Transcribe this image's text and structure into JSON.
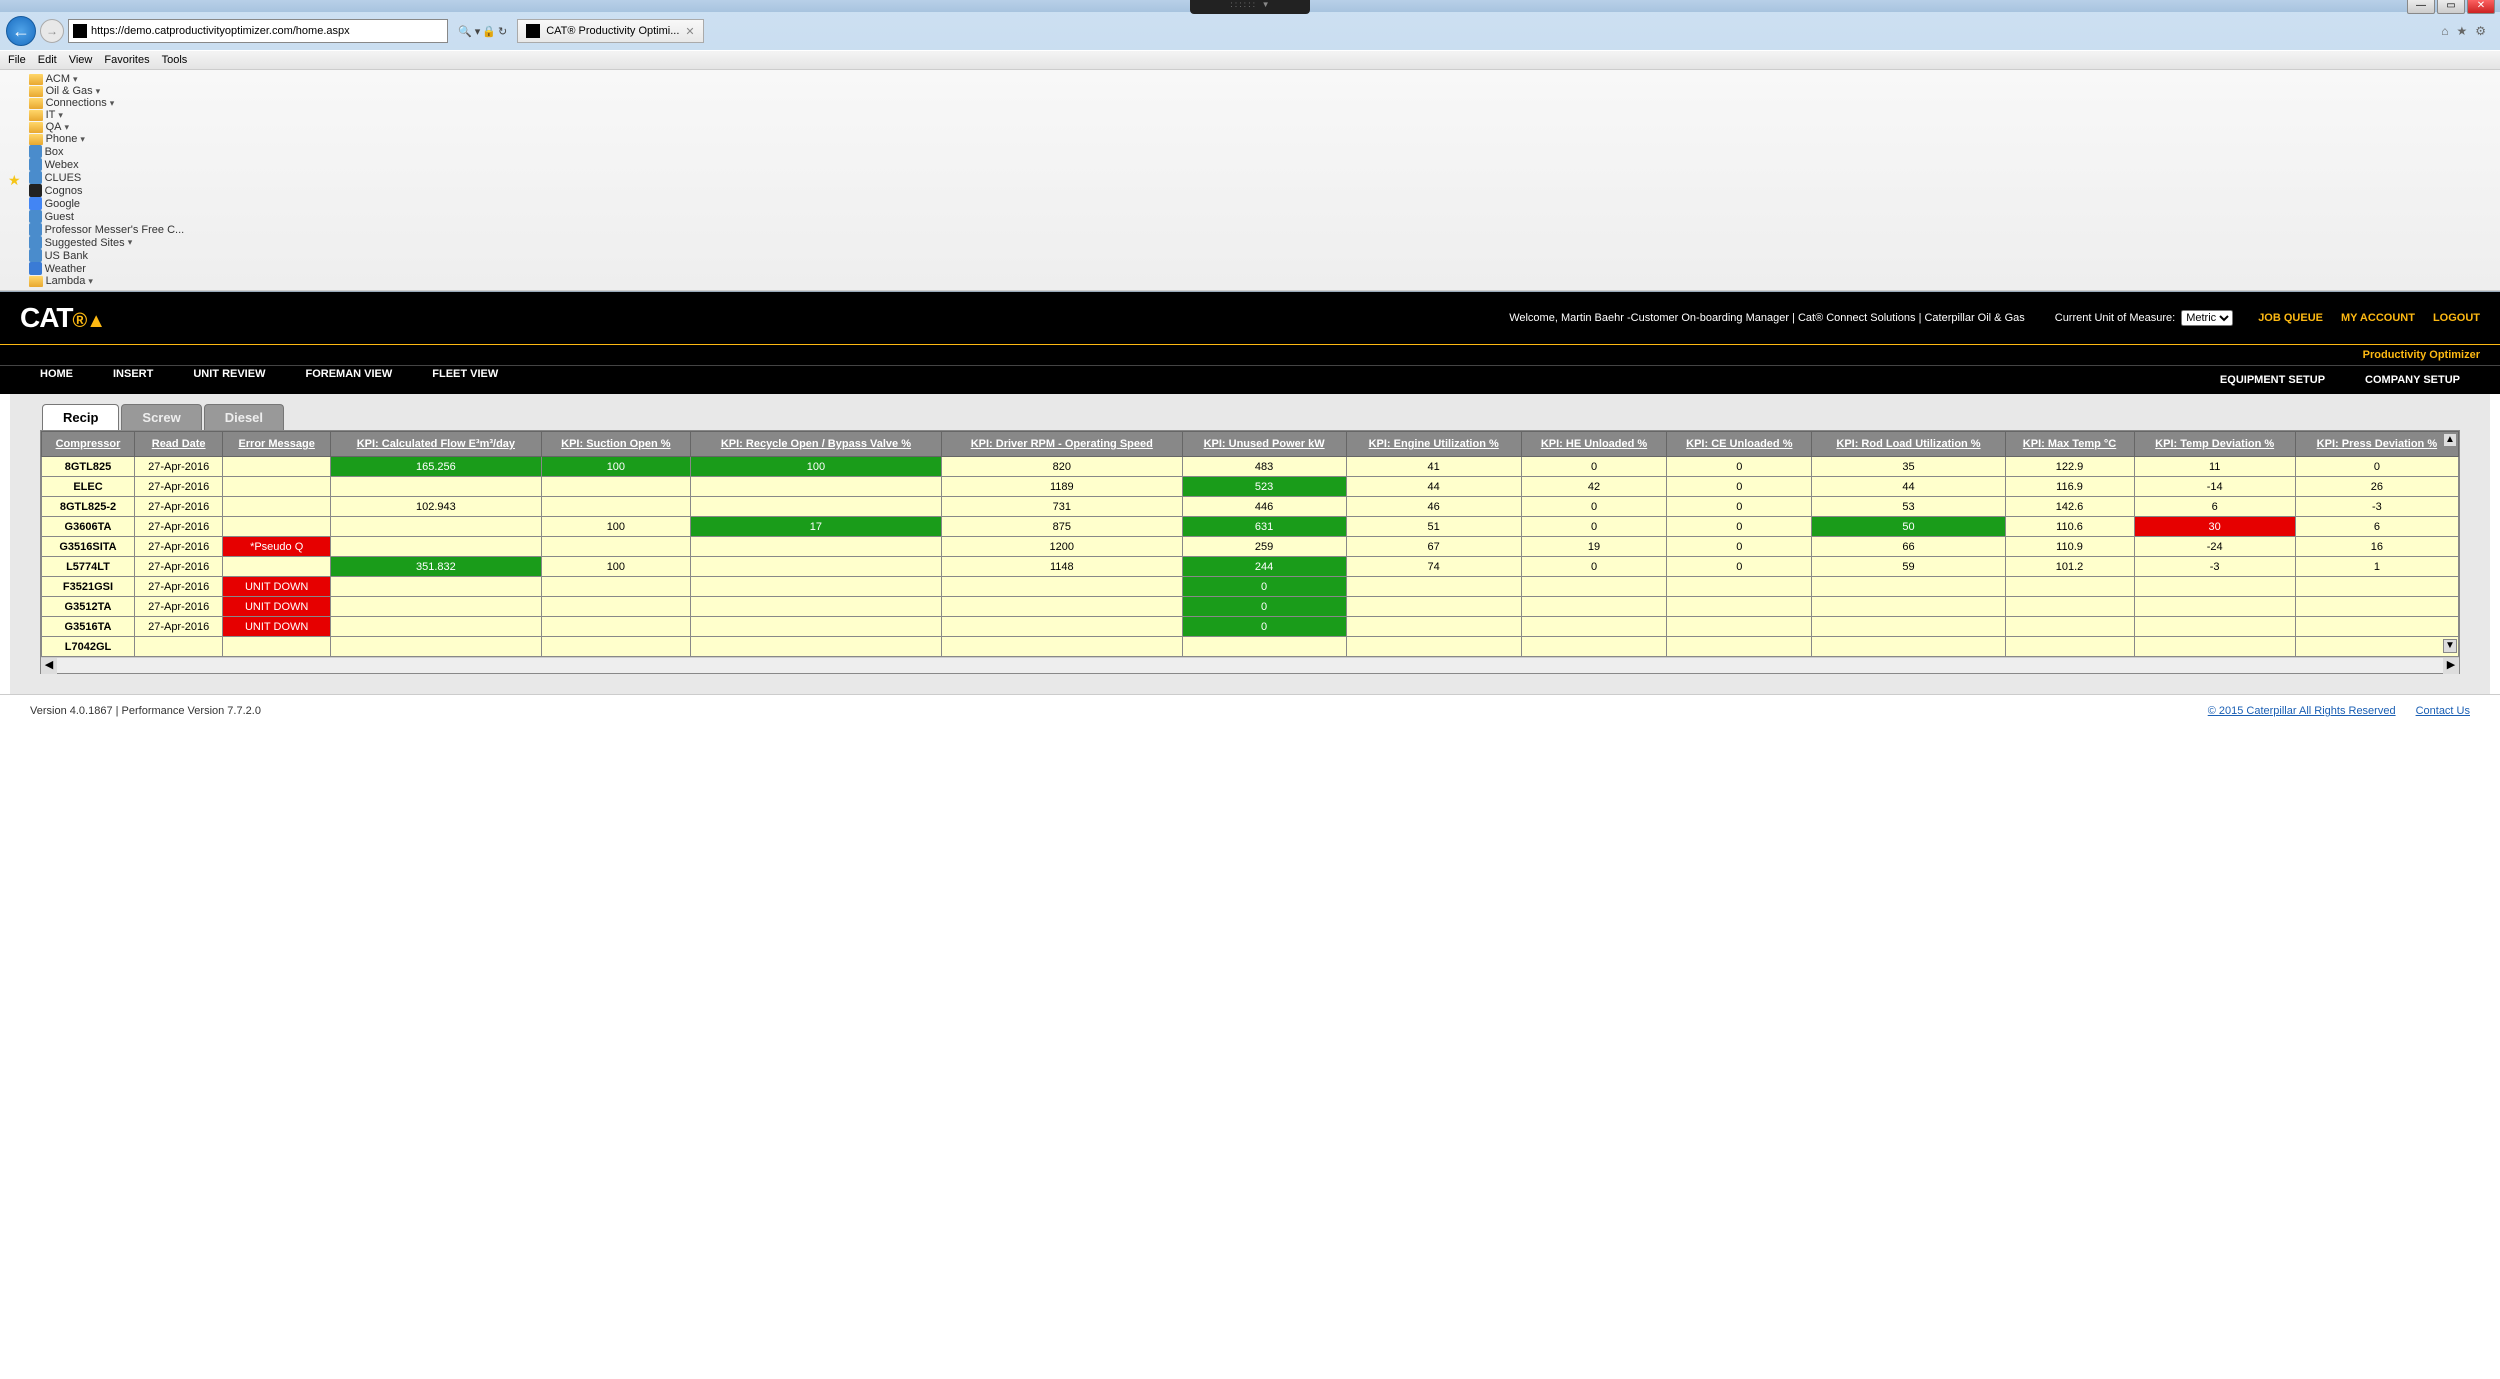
{
  "browser": {
    "url": "https://demo.catproductivityoptimizer.com/home.aspx",
    "tab_title": "CAT® Productivity Optimi...",
    "menus": [
      "File",
      "Edit",
      "View",
      "Favorites",
      "Tools"
    ],
    "favorites": [
      {
        "type": "folder",
        "label": "ACM",
        "arrow": true
      },
      {
        "type": "folder",
        "label": "Oil & Gas",
        "arrow": true
      },
      {
        "type": "folder",
        "label": "Connections",
        "arrow": true
      },
      {
        "type": "folder",
        "label": "IT",
        "arrow": true
      },
      {
        "type": "folder",
        "label": "QA",
        "arrow": true
      },
      {
        "type": "folder",
        "label": "Phone",
        "arrow": true
      },
      {
        "type": "icon",
        "label": "Box"
      },
      {
        "type": "icon",
        "label": "Webex"
      },
      {
        "type": "icon",
        "label": "CLUES"
      },
      {
        "type": "icon",
        "label": "Cognos",
        "bg": "#222"
      },
      {
        "type": "icon",
        "label": "Google",
        "bg": "#4285f4"
      },
      {
        "type": "icon",
        "label": "Guest"
      },
      {
        "type": "icon",
        "label": "Professor Messer's Free C..."
      },
      {
        "type": "icon",
        "label": "Suggested Sites",
        "arrow": true
      },
      {
        "type": "icon",
        "label": "US Bank"
      },
      {
        "type": "icon",
        "label": "Weather",
        "bg": "#3a7bd5"
      },
      {
        "type": "folder",
        "label": "Lambda",
        "arrow": true
      }
    ]
  },
  "header": {
    "logo_text": "CAT",
    "welcome": "Welcome, Martin Baehr -Customer On-boarding Manager | Cat® Connect Solutions | Caterpillar Oil & Gas",
    "uom_label": "Current Unit of Measure:",
    "uom_value": "Metric",
    "links": {
      "job_queue": "JOB QUEUE",
      "my_account": "MY ACCOUNT",
      "logout": "LOGOUT"
    },
    "product_name": "Productivity Optimizer",
    "nav": [
      "HOME",
      "INSERT",
      "UNIT REVIEW",
      "FOREMAN VIEW",
      "FLEET VIEW"
    ],
    "nav_right": [
      "EQUIPMENT SETUP",
      "COMPANY SETUP"
    ]
  },
  "tabs": {
    "recip": "Recip",
    "screw": "Screw",
    "diesel": "Diesel"
  },
  "columns": [
    "Compressor",
    "Read Date",
    "Error Message",
    "KPI: Calculated Flow E³m³/day",
    "KPI: Suction Open %",
    "KPI: Recycle Open / Bypass Valve %",
    "KPI: Driver RPM - Operating Speed",
    "KPI: Unused Power kW",
    "KPI: Engine Utilization %",
    "KPI: HE Unloaded %",
    "KPI: CE Unloaded %",
    "KPI: Rod Load Utilization %",
    "KPI: Max Temp °C",
    "KPI: Temp Deviation %",
    "KPI: Press Deviation %"
  ],
  "rows": [
    {
      "c": [
        "8GTL825",
        "27-Apr-2016",
        "",
        "165.256",
        "100",
        "100",
        "820",
        "483",
        "41",
        "0",
        "0",
        "35",
        "122.9",
        "11",
        "0"
      ],
      "hl": {
        "3": "green",
        "4": "green",
        "5": "green"
      }
    },
    {
      "c": [
        "ELEC",
        "27-Apr-2016",
        "",
        "",
        "",
        "",
        "1189",
        "523",
        "44",
        "42",
        "0",
        "44",
        "116.9",
        "-14",
        "26"
      ],
      "hl": {
        "7": "green"
      }
    },
    {
      "c": [
        "8GTL825-2",
        "27-Apr-2016",
        "",
        "102.943",
        "",
        "",
        "731",
        "446",
        "46",
        "0",
        "0",
        "53",
        "142.6",
        "6",
        "-3"
      ],
      "hl": {}
    },
    {
      "c": [
        "G3606TA",
        "27-Apr-2016",
        "",
        "",
        "100",
        "17",
        "875",
        "631",
        "51",
        "0",
        "0",
        "50",
        "110.6",
        "30",
        "6"
      ],
      "hl": {
        "5": "green",
        "7": "green",
        "11": "green",
        "13": "red"
      }
    },
    {
      "c": [
        "G3516SITA",
        "27-Apr-2016",
        "*Pseudo Q",
        "",
        "",
        "",
        "1200",
        "259",
        "67",
        "19",
        "0",
        "66",
        "110.9",
        "-24",
        "16"
      ],
      "hl": {
        "2": "red"
      }
    },
    {
      "c": [
        "L5774LT",
        "27-Apr-2016",
        "",
        "351.832",
        "100",
        "",
        "1148",
        "244",
        "74",
        "0",
        "0",
        "59",
        "101.2",
        "-3",
        "1"
      ],
      "hl": {
        "3": "green",
        "7": "green"
      }
    },
    {
      "c": [
        "F3521GSI",
        "27-Apr-2016",
        "UNIT DOWN",
        "",
        "",
        "",
        "",
        "0",
        "",
        "",
        "",
        "",
        "",
        "",
        ""
      ],
      "hl": {
        "2": "red",
        "7": "green"
      }
    },
    {
      "c": [
        "G3512TA",
        "27-Apr-2016",
        "UNIT DOWN",
        "",
        "",
        "",
        "",
        "0",
        "",
        "",
        "",
        "",
        "",
        "",
        ""
      ],
      "hl": {
        "2": "red",
        "7": "green"
      }
    },
    {
      "c": [
        "G3516TA",
        "27-Apr-2016",
        "UNIT DOWN",
        "",
        "",
        "",
        "",
        "0",
        "",
        "",
        "",
        "",
        "",
        "",
        ""
      ],
      "hl": {
        "2": "red",
        "7": "green"
      }
    },
    {
      "c": [
        "L7042GL",
        "",
        "",
        "",
        "",
        "",
        "",
        "",
        "",
        "",
        "",
        "",
        "",
        "",
        ""
      ],
      "hl": {}
    }
  ],
  "footer": {
    "version": "Version 4.0.1867 | Performance Version 7.7.2.0",
    "copyright": "© 2015 Caterpillar All Rights Reserved",
    "contact": "Contact Us"
  }
}
